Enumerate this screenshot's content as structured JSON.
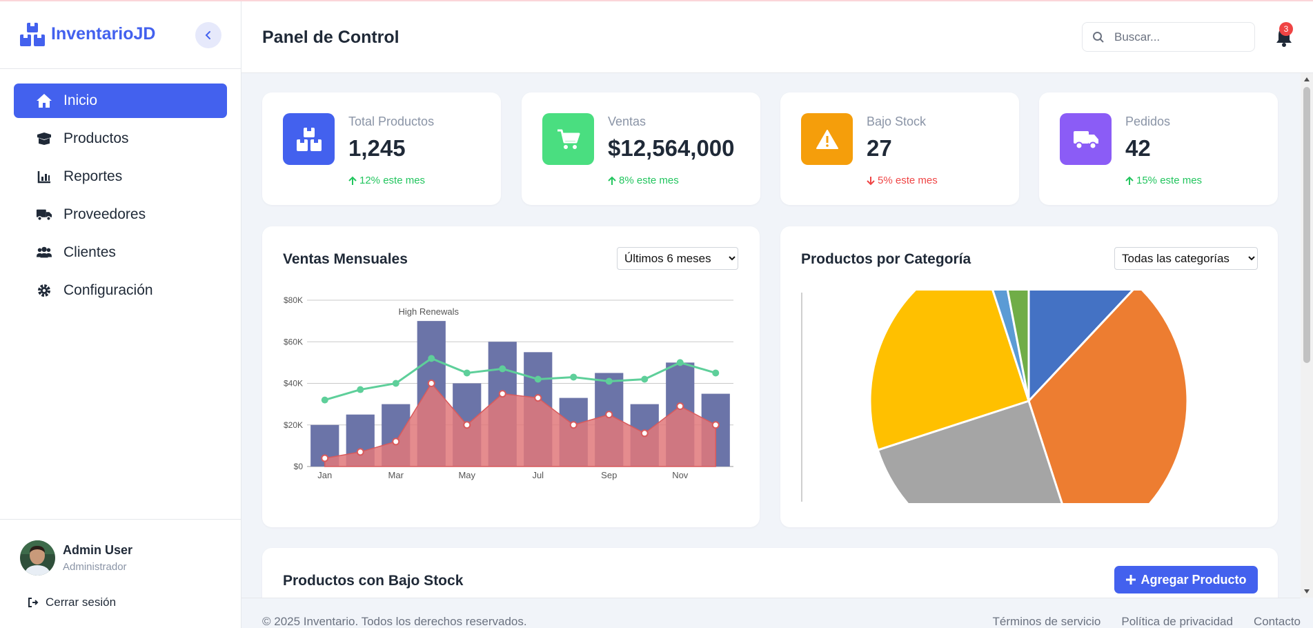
{
  "app": {
    "name": "InventarioJD"
  },
  "sidebar": {
    "items": [
      {
        "label": "Inicio",
        "icon": "home-icon"
      },
      {
        "label": "Productos",
        "icon": "box-open-icon"
      },
      {
        "label": "Reportes",
        "icon": "bar-chart-icon"
      },
      {
        "label": "Proveedores",
        "icon": "truck-icon"
      },
      {
        "label": "Clientes",
        "icon": "users-icon"
      },
      {
        "label": "Configuración",
        "icon": "gear-icon"
      }
    ],
    "active_index": 0,
    "user": {
      "name": "Admin User",
      "role": "Administrador"
    },
    "logout_label": "Cerrar sesión"
  },
  "header": {
    "title": "Panel de Control",
    "search_placeholder": "Buscar...",
    "notification_count": "3"
  },
  "stats": [
    {
      "label": "Total Productos",
      "value": "1,245",
      "trend": "12% este mes",
      "direction": "up",
      "color": "#4361ee",
      "icon": "boxes-icon"
    },
    {
      "label": "Ventas",
      "value": "$12,564,000",
      "trend": "8% este mes",
      "direction": "up",
      "color": "#4ade80",
      "icon": "cart-icon"
    },
    {
      "label": "Bajo Stock",
      "value": "27",
      "trend": "5% este mes",
      "direction": "down",
      "color": "#f59e0b",
      "icon": "warning-icon"
    },
    {
      "label": "Pedidos",
      "value": "42",
      "trend": "15% este mes",
      "direction": "up",
      "color": "#8b5cf6",
      "icon": "truck-icon"
    }
  ],
  "sales_panel": {
    "title": "Ventas Mensuales",
    "filter": "Últimos 6 meses"
  },
  "category_panel": {
    "title": "Productos por Categoría",
    "filter": "Todas las categorías"
  },
  "lowstock_panel": {
    "title": "Productos con Bajo Stock",
    "add_label": "Agregar Producto"
  },
  "footer": {
    "copyright": "© 2025 Inventario. Todos los derechos reservados.",
    "links": [
      "Términos de servicio",
      "Política de privacidad",
      "Contacto"
    ]
  },
  "chart_data": [
    {
      "type": "bar",
      "x_tick_labels": [
        "Jan",
        "Mar",
        "May",
        "Jul",
        "Sep",
        "Nov"
      ],
      "y_tick_labels": [
        "$0",
        "$20K",
        "$40K",
        "$60K",
        "$80K"
      ],
      "ylim": [
        0,
        80000
      ],
      "annotation": "High Renewals",
      "series": [
        {
          "type": "bar",
          "color": "#6b74a8",
          "values": [
            20000,
            25000,
            30000,
            70000,
            40000,
            60000,
            55000,
            33000,
            45000,
            30000,
            50000,
            35000
          ]
        },
        {
          "type": "line",
          "color": "#5ecf9a",
          "values": [
            32000,
            37000,
            40000,
            52000,
            45000,
            47000,
            42000,
            43000,
            41000,
            42000,
            50000,
            45000
          ]
        },
        {
          "type": "area",
          "color": "#e0787a",
          "values": [
            4000,
            7000,
            12000,
            40000,
            20000,
            35000,
            33000,
            20000,
            25000,
            16000,
            29000,
            20000
          ]
        }
      ],
      "grid": true
    },
    {
      "type": "pie",
      "slices": [
        {
          "value": 12,
          "color": "#4472c4"
        },
        {
          "value": 33,
          "color": "#ed7d31"
        },
        {
          "value": 25,
          "color": "#a5a5a5"
        },
        {
          "value": 25,
          "color": "#ffc000"
        },
        {
          "value": 2,
          "color": "#5b9bd5"
        },
        {
          "value": 3,
          "color": "#70ad47"
        }
      ]
    }
  ]
}
